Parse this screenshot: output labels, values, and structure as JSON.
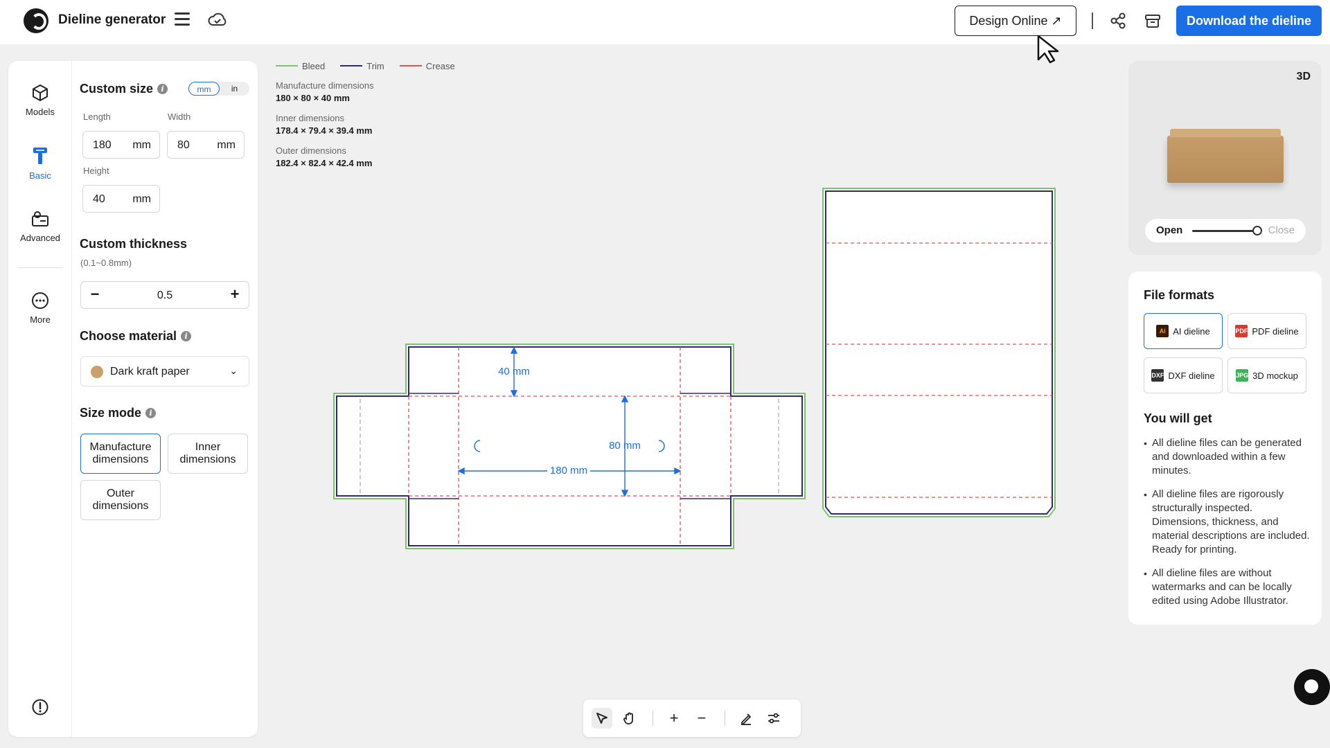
{
  "app": {
    "title": "Dieline generator"
  },
  "header": {
    "design_online": "Design Online ↗",
    "download": "Download the dieline"
  },
  "rail": {
    "items": [
      {
        "label": "Models",
        "icon": "cube-icon"
      },
      {
        "label": "Basic",
        "icon": "basic-tool-icon"
      },
      {
        "label": "Advanced",
        "icon": "advanced-icon"
      },
      {
        "label": "More",
        "icon": "more-icon"
      }
    ]
  },
  "custom_size": {
    "title": "Custom size",
    "unit_options": [
      "mm",
      "in"
    ],
    "unit_selected": "mm",
    "length": {
      "label": "Length",
      "value": "180",
      "unit": "mm"
    },
    "width": {
      "label": "Width",
      "value": "80",
      "unit": "mm"
    },
    "height": {
      "label": "Height",
      "value": "40",
      "unit": "mm"
    }
  },
  "thickness": {
    "title": "Custom thickness",
    "range": "(0.1~0.8mm)",
    "value": "0.5",
    "minus": "−",
    "plus": "+"
  },
  "material": {
    "title": "Choose material",
    "value": "Dark kraft paper",
    "swatch_color": "#c9a06a"
  },
  "size_mode": {
    "title": "Size mode",
    "options": [
      "Manufacture dimensions",
      "Inner dimensions",
      "Outer dimensions"
    ],
    "selected": "Manufacture dimensions"
  },
  "legend": [
    {
      "label": "Bleed",
      "color": "#7cc46a"
    },
    {
      "label": "Trim",
      "color": "#2a2a7a"
    },
    {
      "label": "Crease",
      "color": "#e05050"
    }
  ],
  "dimensions": [
    {
      "label": "Manufacture dimensions",
      "value": "180 × 80 × 40 mm"
    },
    {
      "label": "Inner dimensions",
      "value": "178.4 × 79.4 × 39.4 mm"
    },
    {
      "label": "Outer dimensions",
      "value": "182.4 × 82.4 × 42.4 mm"
    }
  ],
  "dieline_labels": {
    "height": "40 mm",
    "width": "80 mm",
    "length": "180 mm"
  },
  "preview": {
    "badge": "3D",
    "open": "Open",
    "close": "Close",
    "open_fraction": 0.85
  },
  "formats": {
    "title": "File formats",
    "items": [
      {
        "label": "AI dieline",
        "icon_text": "Ai",
        "color": "#3a1a00"
      },
      {
        "label": "PDF dieline",
        "icon_text": "PDF",
        "color": "#d93a2a"
      },
      {
        "label": "DXF dieline",
        "icon_text": "DXF",
        "color": "#333333"
      },
      {
        "label": "3D mockup",
        "icon_text": "JPG",
        "color": "#3cb55a"
      }
    ],
    "selected": "AI dieline"
  },
  "you_get": {
    "title": "You will get",
    "items": [
      "All dieline files can be generated and downloaded within a few minutes.",
      "All dieline files are rigorously structurally inspected. Dimensions, thickness, and material descriptions are included. Ready for printing.",
      "All dieline files are without watermarks and can be locally edited using Adobe Illustrator."
    ]
  },
  "colors": {
    "accent": "#1b6fe6",
    "bleed": "#7cc46a",
    "trim": "#2a2a7a",
    "crease": "#e05050"
  }
}
